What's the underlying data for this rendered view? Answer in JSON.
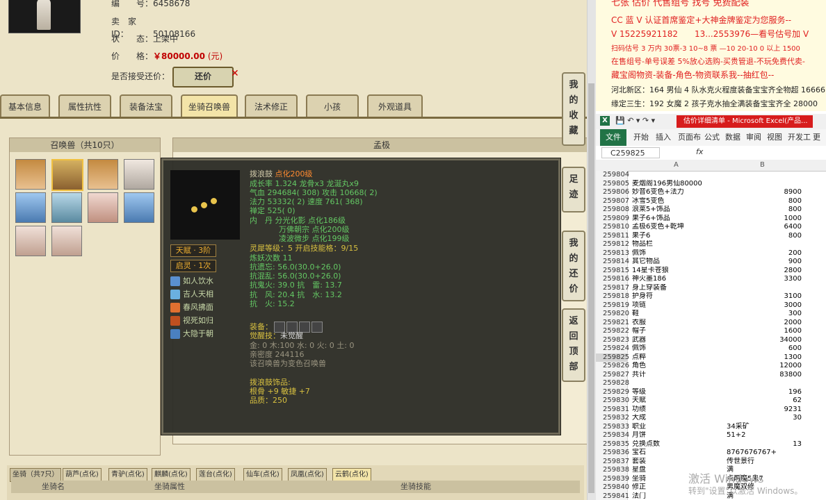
{
  "game": {
    "info": [
      {
        "label": "编　　号：",
        "value": "6458678"
      },
      {
        "label": "卖　家　ID：",
        "value": "50108166"
      },
      {
        "label": "状　　态：",
        "value": "上架中"
      },
      {
        "label": "价　　格：",
        "value": "￥80000.00",
        "unit": "(元)"
      }
    ],
    "accept_label": "是否接受还价：",
    "counter_offer_button": "还价",
    "tabs": [
      "基本信息",
      "属性抗性",
      "装备法宝",
      "坐骑召唤兽",
      "法术修正",
      "小孩",
      "外观道具"
    ],
    "active_tab": "坐骑召唤兽",
    "side_buttons": [
      "我的收藏",
      "足迹",
      "我的还价",
      "返回顶部"
    ],
    "pets_header": "召唤兽（共10只）",
    "detail_header": "孟极",
    "tooltip": {
      "name": "拨浪鼓",
      "name_suffix": "点化200级",
      "line_growth": "成长率 1.324 龙骨x3 龙涎丸x9",
      "line_hp": "气血 294684( 308) 攻击 10668( 2)",
      "line_mp": "法力 53332( 2) 速度 761( 368)",
      "line_sense": "禅定 525( 0)",
      "neidan": [
        "内　丹 分光化影 点化186级",
        "万佛朝宗 点化200级",
        "凌波微步 点化199级"
      ],
      "line_lingxi": "灵犀等级：5 开启技能格：9/15",
      "line_lianyao": "炼妖次数 11",
      "resist": [
        "抗遗忘: 56.0(30.0+26.0)",
        "抗混乱: 56.0(30.0+26.0)",
        "抗鬼火: 39.0 抗　雷: 13.7",
        "抗　风: 20.4 抗　水: 13.2",
        "抗　火: 15.2"
      ],
      "badges": [
        "天赋 · 3阶",
        "启灵 · 1次"
      ],
      "skills": [
        "如人饮水",
        "吉人天相",
        "春风拂面",
        "视死如归",
        "大隐于朝"
      ],
      "equip_label": "装备：",
      "awaken": "觉醒技：",
      "awaken_val": "未觉醒",
      "elements": "金: 0 木:100 水: 0 火: 0 土: 0",
      "intimacy": "亲密度 244116",
      "variant_note": "该召唤兽为变色召唤兽",
      "ornament_title": "拨浪鼓饰品:",
      "ornament_stats": "根骨 +9 敏捷 +7",
      "ornament_quality": "品质：250"
    },
    "mounts": {
      "title": "坐骑（共7只）",
      "tabs": [
        "葫芦(点化)",
        "青驴(点化)",
        "麒麟(点化)",
        "莲台(点化)",
        "仙车(点化)",
        "凤凰(点化)",
        "云鹤(点化)"
      ],
      "columns": [
        "坐骑名",
        "坐骑属性",
        "坐骑技能"
      ]
    }
  },
  "ad": {
    "lines": [
      {
        "text": "七张 估价 代售组号 找号 免费配装",
        "color": "#e02020"
      },
      {
        "text": "CC 蓝 V 认证首席鉴定+大神金牌鉴定为您服务--",
        "color": "#e02020"
      },
      {
        "text": "V 15225921182　　13...2553976—看号估号加 V",
        "color": "#e02020"
      },
      {
        "text": "扫码估号 3 万内 30票-3 10~8 票 —10 20-10 0 以上 1500",
        "color": "#e02020"
      },
      {
        "text": "在售组号-单号误差 5%放心选购-买贵管退-不玩免费代卖-",
        "color": "#e02020"
      },
      {
        "text": "藏宝阁物资-装备-角色-物资联系我--抽红包--",
        "color": "#e02020"
      },
      {
        "text": "河北新区：164 男仙 4 队水克火程度装备宝宝齐全物超 16666",
        "color": "#222222"
      },
      {
        "text": "缘定三生：192 女魔 2 孩子克水抽全满装备宝宝齐全 28000",
        "color": "#222222"
      }
    ]
  },
  "excel": {
    "window_title": "估价详细清单 - Microsoft Excel(产品...",
    "ribbon": [
      "文件",
      "开始",
      "插入",
      "页面布",
      "公式",
      "数据",
      "审阅",
      "视图",
      "开发工",
      "更多"
    ],
    "name_box": "C259825",
    "fx": "fx",
    "col_a": "A",
    "col_b": "B",
    "rows": [
      [
        "259804",
        "",
        ""
      ],
      [
        "259805",
        "麦烟阁196男仙80000",
        ""
      ],
      [
        "259806",
        "妙音6变色+法力",
        "8900"
      ],
      [
        "259807",
        "冰雪5变色",
        "800"
      ],
      [
        "259808",
        "浪莱5+饰品",
        "800"
      ],
      [
        "259809",
        "果子6+饰品",
        "1000"
      ],
      [
        "259810",
        "孟极6变色+乾坤",
        "6400"
      ],
      [
        "259811",
        "果子6",
        "800"
      ],
      [
        "259812",
        "物品栏",
        ""
      ],
      [
        "259813",
        "佩饰",
        "200"
      ],
      [
        "259814",
        "其它物品",
        "900"
      ],
      [
        "259815",
        "14星卡苍狼",
        "2800"
      ],
      [
        "259816",
        "神火墨186",
        "3300"
      ],
      [
        "259817",
        "身上穿装备",
        ""
      ],
      [
        "259818",
        "护身符",
        "3100"
      ],
      [
        "259819",
        "项链",
        "3000"
      ],
      [
        "259820",
        "鞋",
        "300"
      ],
      [
        "259821",
        "衣服",
        "2000"
      ],
      [
        "259822",
        "帽子",
        "1600"
      ],
      [
        "259823",
        "武器",
        "34000"
      ],
      [
        "259824",
        "佩饰",
        "600"
      ],
      [
        "259825",
        "点粹",
        "1300"
      ],
      [
        "259826",
        "角色",
        "12000"
      ],
      [
        "259827",
        "共计",
        "83800"
      ],
      [
        "259828",
        "",
        ""
      ],
      [
        "259829",
        "等级",
        "196"
      ],
      [
        "259830",
        "天赋",
        "62"
      ],
      [
        "259831",
        "功绩",
        "9231"
      ],
      [
        "259832",
        "大成",
        "30"
      ],
      [
        "259833",
        "职业",
        "34采矿"
      ],
      [
        "259834",
        "月饼",
        "51+2"
      ],
      [
        "259835",
        "兑换点数",
        "13"
      ],
      [
        "259836",
        "宝石",
        "8767676767+"
      ],
      [
        "259837",
        "套装",
        "传世景行"
      ],
      [
        "259838",
        "星盘",
        "满"
      ],
      [
        "259839",
        "坐骑",
        "点两魔5鬼7"
      ],
      [
        "259840",
        "修正",
        "男魔双修"
      ],
      [
        "259841",
        "法门",
        "满"
      ]
    ]
  },
  "watermark": {
    "line1": "激活 Windows",
    "line2": "转到\"设置\"以激活 Windows。"
  }
}
